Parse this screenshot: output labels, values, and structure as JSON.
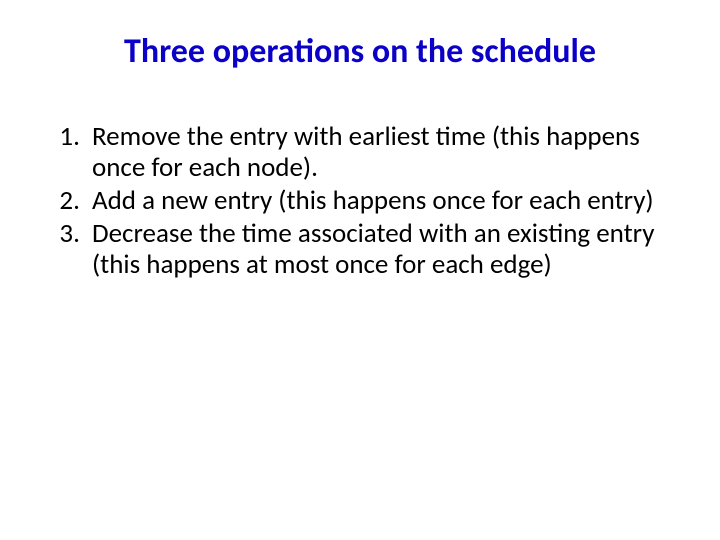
{
  "title": "Three operations on the schedule",
  "items": [
    "Remove the entry with earliest time (this happens once for each node).",
    "Add a new entry (this happens once for each entry)",
    "Decrease the time associated with an existing entry (this happens at most once for each edge)"
  ]
}
